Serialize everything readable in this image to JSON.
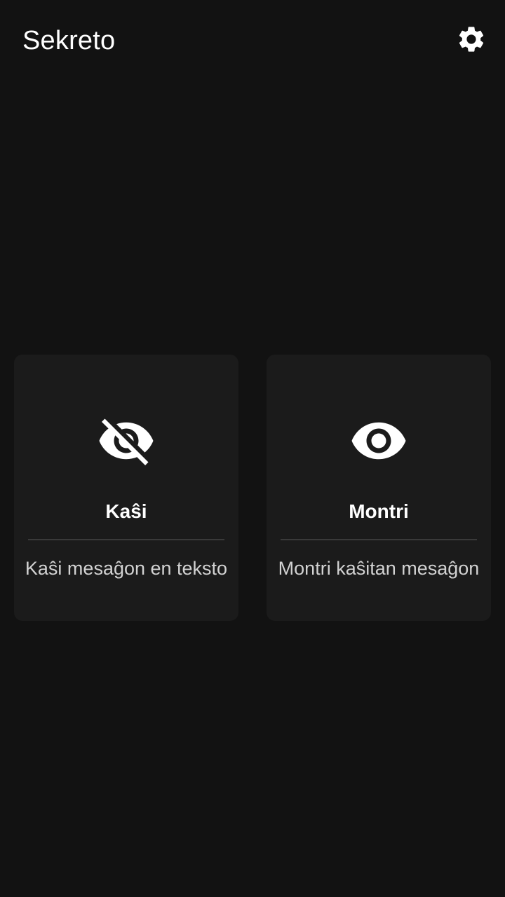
{
  "app_bar": {
    "title": "Sekreto",
    "settings_icon": "gear-icon"
  },
  "cards": [
    {
      "icon": "eye-off-icon",
      "title": "Kaŝi",
      "description": "Kaŝi mesaĝon en teksto"
    },
    {
      "icon": "eye-icon",
      "title": "Montri",
      "description": "Montri kaŝitan mesaĝon"
    }
  ],
  "colors": {
    "background": "#121212",
    "card": "#1b1b1b",
    "text_primary": "#ffffff",
    "text_secondary": "#d2d2d2",
    "divider": "#3a3a3a"
  }
}
